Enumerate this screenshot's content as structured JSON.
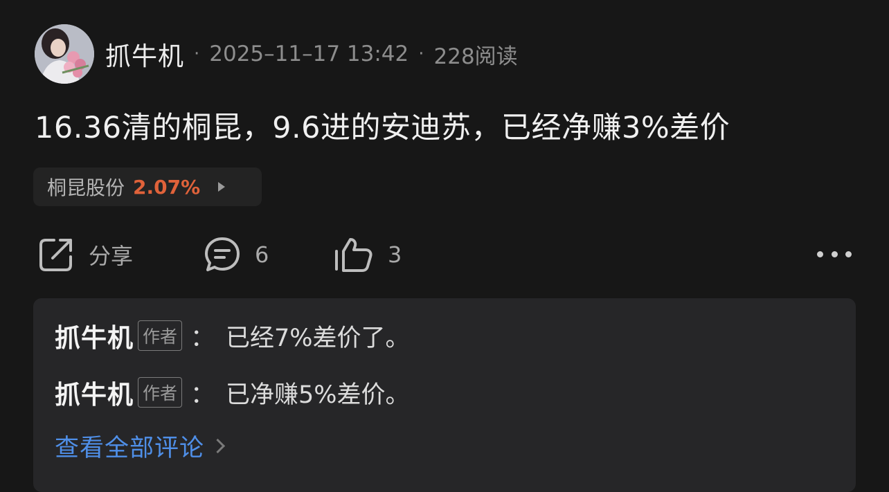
{
  "author": {
    "name": "抓牛机",
    "timestamp": "2025–11–17 13:42",
    "reads": "228阅读",
    "separator": "·"
  },
  "post": {
    "content": "16.36清的桐昆，9.6进的安迪苏，已经净赚3%差价"
  },
  "stock_tag": {
    "name": "桐昆股份",
    "change": "2.07%",
    "change_color": "#e0623a"
  },
  "actions": {
    "share_label": "分享",
    "comment_count": "6",
    "like_count": "3"
  },
  "comments": {
    "items": [
      {
        "author": "抓牛机",
        "badge": "作者",
        "colon": "：",
        "text": "已经7%差价了。"
      },
      {
        "author": "抓牛机",
        "badge": "作者",
        "colon": "：",
        "text": "已净赚5%差价。"
      }
    ],
    "view_all_label": "查看全部评论",
    "link_color": "#4f8fe8"
  },
  "icons": {
    "share": "share-icon",
    "comment": "comment-bubble-icon",
    "like": "thumbs-up-icon",
    "more": "more-horizontal-icon"
  }
}
